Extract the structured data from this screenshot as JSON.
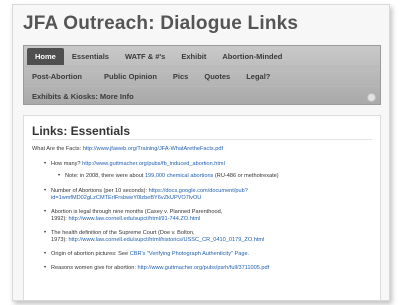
{
  "site": {
    "title": "JFA Outreach: Dialogue Links"
  },
  "nav": {
    "row1": [
      "Home",
      "Essentials",
      "WATF & #'s",
      "Exhibit",
      "Abortion-Minded"
    ],
    "row2": [
      "Post-Abortion",
      "Public Opinion",
      "Pics",
      "Quotes",
      "Legal?"
    ],
    "row3": [
      "Exhibits & Kiosks: More Info"
    ]
  },
  "content": {
    "title": "Links: Essentials",
    "facts_label": "What Are the Facts:",
    "facts_url": "http://www.jfaweb.org/Training/JFA-WhatAretheFacts.pdf",
    "how_many_label": "How many?",
    "how_many_url": "http://www.guttmacher.org/pubs/fb_induced_abortion.html",
    "note_pre": "Note: in 2008, there were about",
    "note_link": "199,000 chemical abortions",
    "note_post": "(RU-486 or methotrexate)",
    "number_label": "Number of Abortions (per 10 seconds):",
    "number_url1": "https://docs.google.com/document/pub?",
    "number_url2": "id=1wmfMD02gLzCMTErlFrsbweY0lzbeBY6vZkUPVO7lvOU",
    "legal_line1": "Abortion is legal through nine months (Casey v. Planned Parenthood,",
    "legal_year": "1992):",
    "legal_url": "http://www.law.cornell.edu/supct/html/91-744.ZO.html",
    "health_line1": "The health definition of the Supreme Court (Doe v. Bolton,",
    "health_year": "1973):",
    "health_url": "http://www.law.cornell.edu/supct/html/historics/USSC_CR_0410_0179_ZO.html",
    "origin_label": "Origin of abortion pictures:  See",
    "origin_link": "CBR's \"Verifying Photograph Authenticity\" Page.",
    "reasons_label": "Reasons women give for abortion:",
    "reasons_url": "http://www.guttmacher.org/pubs/psrh/full/3711005.pdf"
  }
}
